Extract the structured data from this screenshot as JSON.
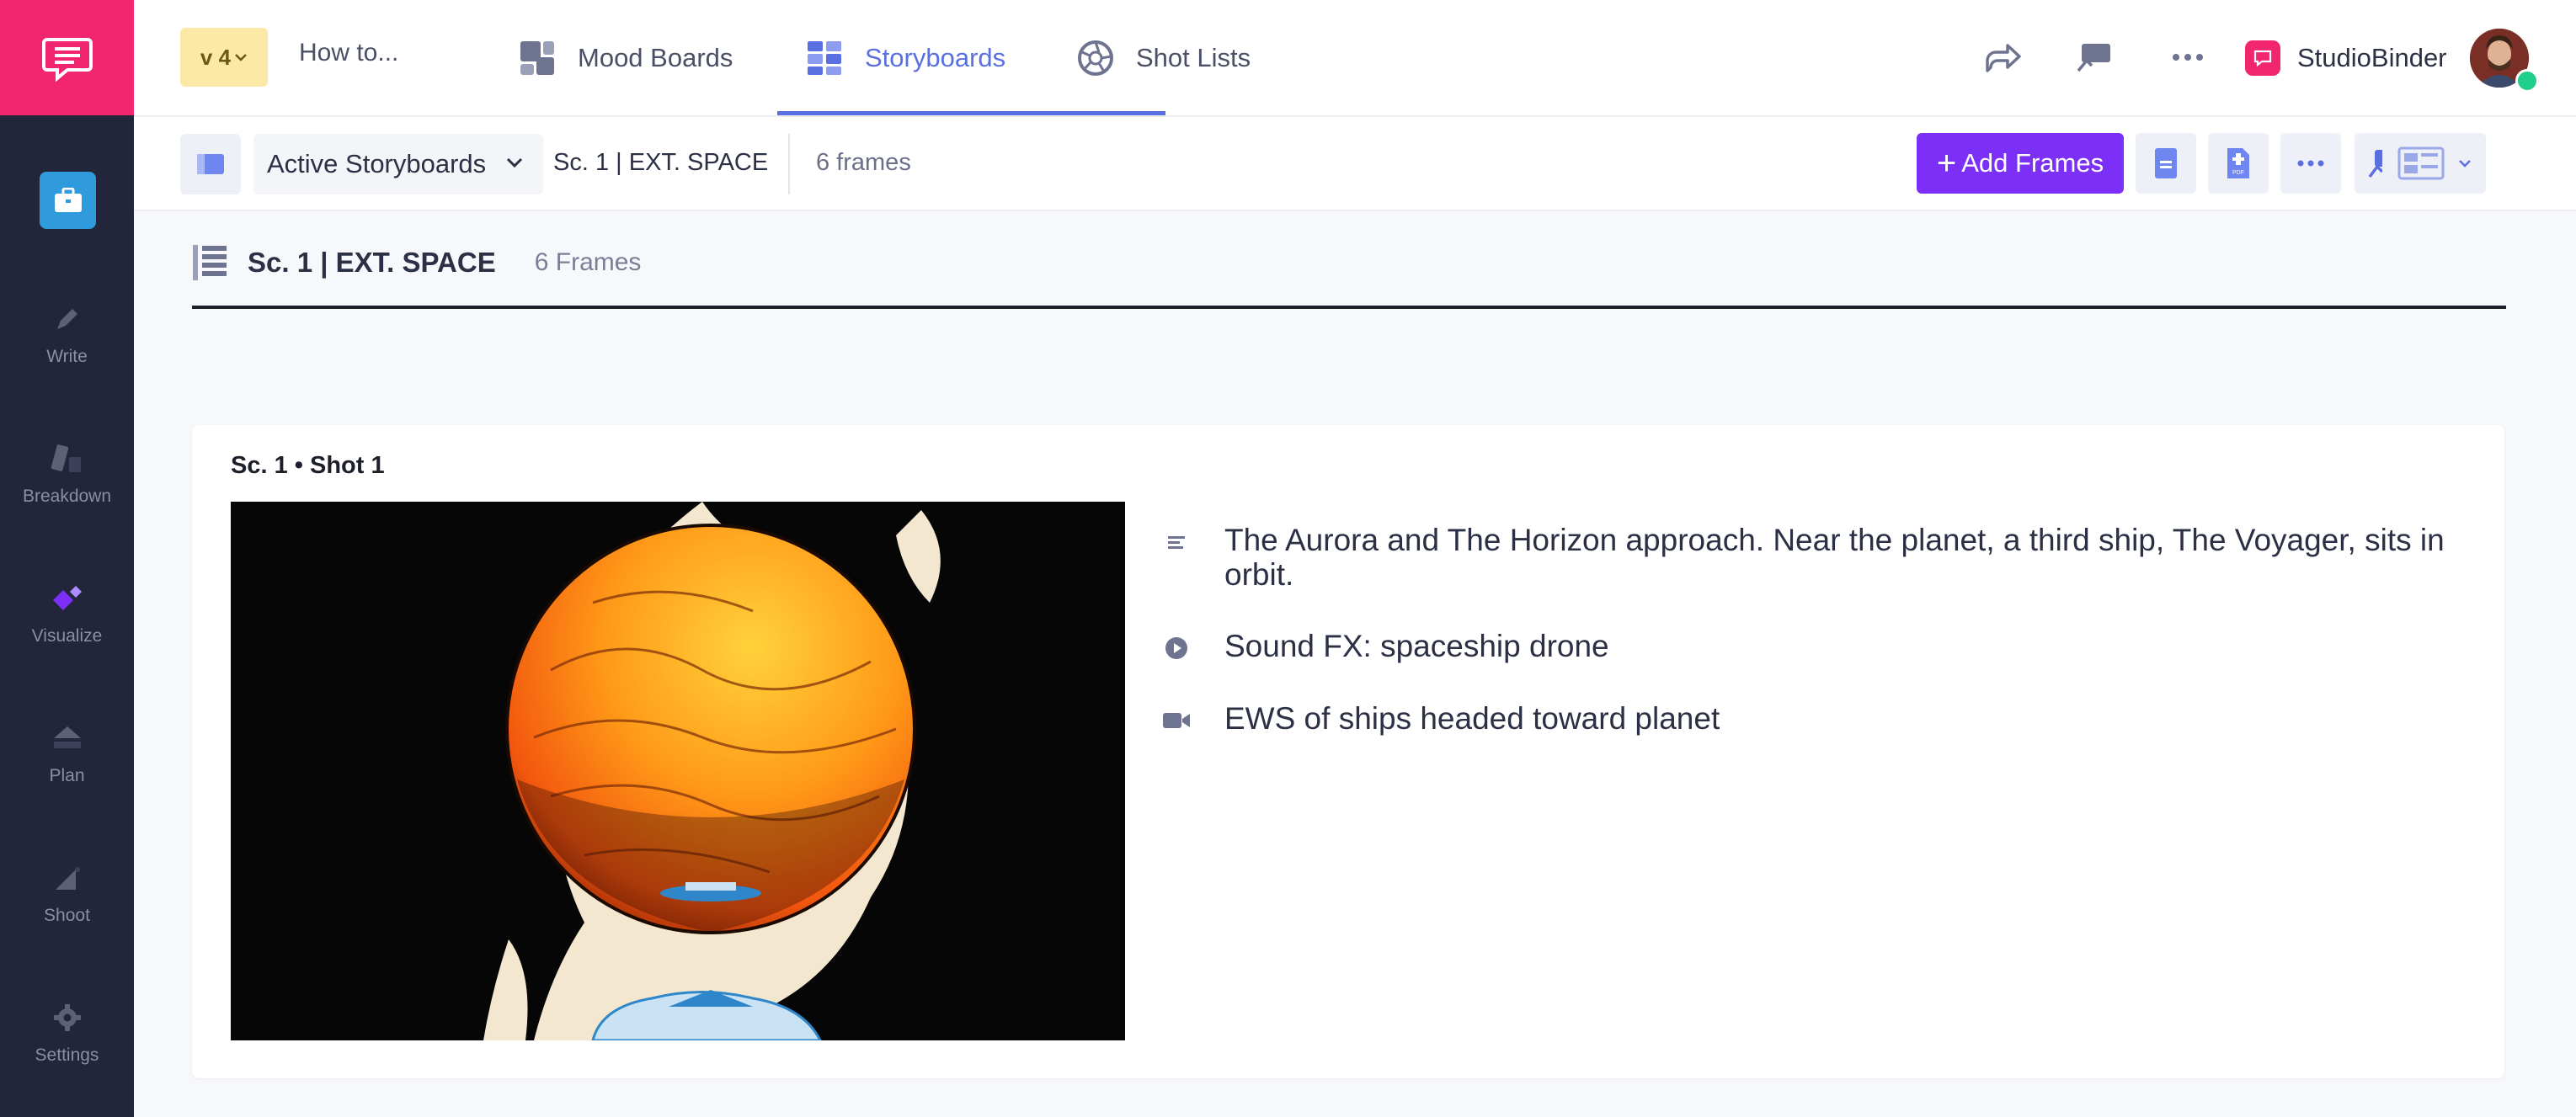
{
  "sidebar": {
    "items": [
      {
        "label": "Write",
        "icon": "pencil-icon"
      },
      {
        "label": "Breakdown",
        "icon": "breakdown-icon"
      },
      {
        "label": "Visualize",
        "icon": "visualize-icon"
      },
      {
        "label": "Plan",
        "icon": "plan-icon"
      },
      {
        "label": "Shoot",
        "icon": "shoot-icon"
      },
      {
        "label": "Settings",
        "icon": "gear-icon"
      }
    ],
    "active_icon": "briefcase-icon"
  },
  "header": {
    "version": "v 4",
    "project_title": "How to...",
    "tabs": [
      {
        "label": "Mood Boards",
        "icon": "mood-boards-icon"
      },
      {
        "label": "Storyboards",
        "icon": "storyboards-icon"
      },
      {
        "label": "Shot Lists",
        "icon": "shot-lists-icon"
      }
    ],
    "brand_name": "StudioBinder"
  },
  "toolbar": {
    "dropdown_label": "Active Storyboards",
    "scene_label": "Sc. 1 | EXT. SPACE",
    "frames_label": "6 frames",
    "add_frames_label": "Add Frames"
  },
  "scene": {
    "title": "Sc. 1 | EXT. SPACE",
    "frames": "6 Frames"
  },
  "shot": {
    "label": "Sc. 1  •  Shot  1",
    "description": "The Aurora and The Horizon approach. Near the planet, a third ship, The Voyager, sits in orbit.",
    "sound": "Sound FX: spaceship drone",
    "camera": "EWS of ships headed toward planet"
  },
  "colors": {
    "accent": "#5a6fe0",
    "brand": "#f2256f",
    "add_button": "#7b2ff7",
    "sidebar_bg": "#23263a"
  }
}
